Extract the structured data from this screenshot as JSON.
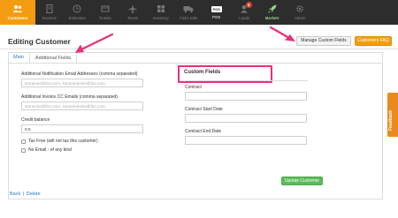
{
  "nav": {
    "items": [
      {
        "label": "Customers",
        "icon": "users-icon"
      },
      {
        "label": "Invoices",
        "icon": "invoice-icon"
      },
      {
        "label": "Estimates",
        "icon": "clock-icon"
      },
      {
        "label": "Tickets",
        "icon": "ticket-icon"
      },
      {
        "label": "Rents",
        "icon": "plane-icon"
      },
      {
        "label": "Inventory",
        "icon": "inventory-icon"
      },
      {
        "label": "Field Jobs",
        "icon": "truck-icon"
      },
      {
        "label": "POS",
        "icon": "pos-icon"
      },
      {
        "label": "Leads",
        "icon": "leads-icon",
        "badge": "4"
      },
      {
        "label": "Marketr",
        "icon": "rocket-icon"
      },
      {
        "label": "Admin",
        "icon": "gear-icon"
      }
    ]
  },
  "header": {
    "title": "Editing Customer",
    "manage_button": "Manage Custom Fields",
    "faq_button": "Customers FAQ"
  },
  "tabs": {
    "main": "Main",
    "additional": "Additional Fields"
  },
  "form": {
    "notification_label": "Additional Notification Email Addresses (comma separated)",
    "notification_placeholder": "someone@foo.com, someoneelse@foo.com",
    "cc_label": "Additional Invoice CC Emails (comma separated)",
    "cc_placeholder": "someone@foo.com, someoneelse@foo.com",
    "credit_label": "Credit balance",
    "credit_value": "0.0",
    "tax_free_label": "Tax Free (will not tax this customer)",
    "no_email_label": "No Email - of any kind"
  },
  "custom_fields": {
    "title": "Custom Fields",
    "contract_label": "Contract",
    "start_label": "Contract Start Date",
    "end_label": "Contract End Date"
  },
  "actions": {
    "update_button": "Update Customer",
    "back_link": "Back",
    "separator": "|",
    "delete_link": "Delete"
  },
  "feedback": {
    "label": "Feedback"
  },
  "colors": {
    "nav_bg": "#2d2d2d",
    "accent": "#f39c12",
    "highlight": "#e8317a",
    "success": "#5cb85c",
    "link": "#2a7ab8"
  }
}
